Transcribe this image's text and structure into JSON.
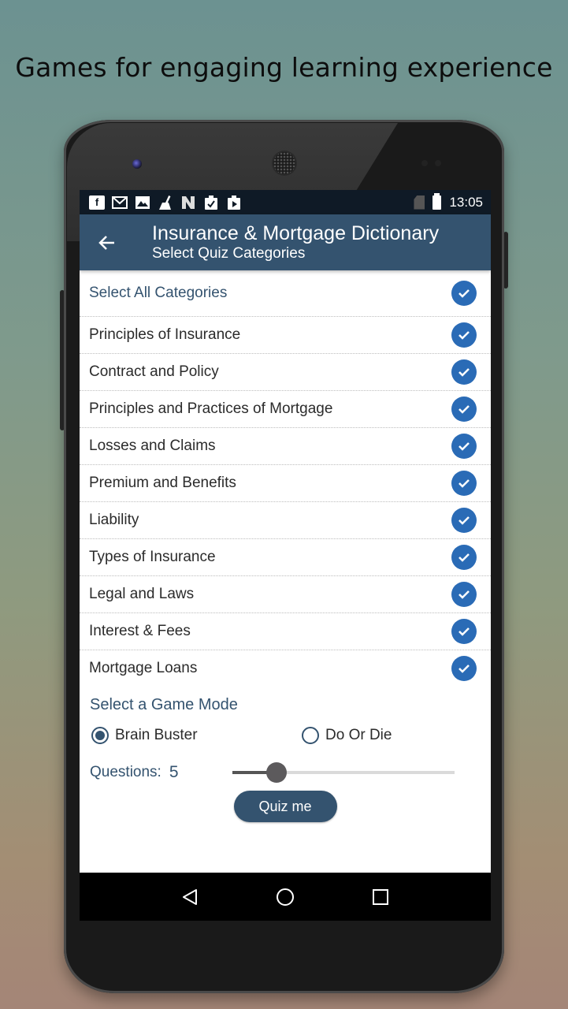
{
  "headline": "Games for engaging learning experience",
  "status_bar": {
    "left_icons": [
      "facebook-icon",
      "gmail-icon",
      "gallery-icon",
      "cleaner-icon",
      "n-app-icon",
      "clipboard-check-icon",
      "play-store-icon"
    ],
    "right_icons": [
      "no-sim-icon",
      "battery-charging-icon"
    ],
    "time": "13:05"
  },
  "app_bar": {
    "back_icon": "arrow-left-icon",
    "title": "Insurance & Mortgage Dictionary",
    "subtitle": "Select Quiz Categories"
  },
  "categories": {
    "select_all": {
      "label": "Select All Categories",
      "checked": true
    },
    "items": [
      {
        "label": "Principles of Insurance",
        "checked": true
      },
      {
        "label": "Contract and Policy",
        "checked": true
      },
      {
        "label": "Principles and Practices of Mortgage",
        "checked": true
      },
      {
        "label": "Losses and Claims",
        "checked": true
      },
      {
        "label": "Premium and Benefits",
        "checked": true
      },
      {
        "label": "Liability",
        "checked": true
      },
      {
        "label": "Types of Insurance",
        "checked": true
      },
      {
        "label": "Legal and Laws",
        "checked": true
      },
      {
        "label": "Interest & Fees",
        "checked": true
      },
      {
        "label": "Mortgage Loans",
        "checked": true
      }
    ]
  },
  "game_mode": {
    "title": "Select a Game Mode",
    "options": [
      {
        "label": "Brain Buster",
        "selected": true
      },
      {
        "label": "Do Or Die",
        "selected": false
      }
    ]
  },
  "questions": {
    "label": "Questions:",
    "value": "5",
    "slider_fraction": 0.2
  },
  "quiz_button": "Quiz me",
  "colors": {
    "primary": "#34536f",
    "check": "#2a6bb6",
    "status_bar": "#0f1a26"
  },
  "nav_bar": [
    "back-triangle-icon",
    "home-circle-icon",
    "recents-square-icon"
  ]
}
